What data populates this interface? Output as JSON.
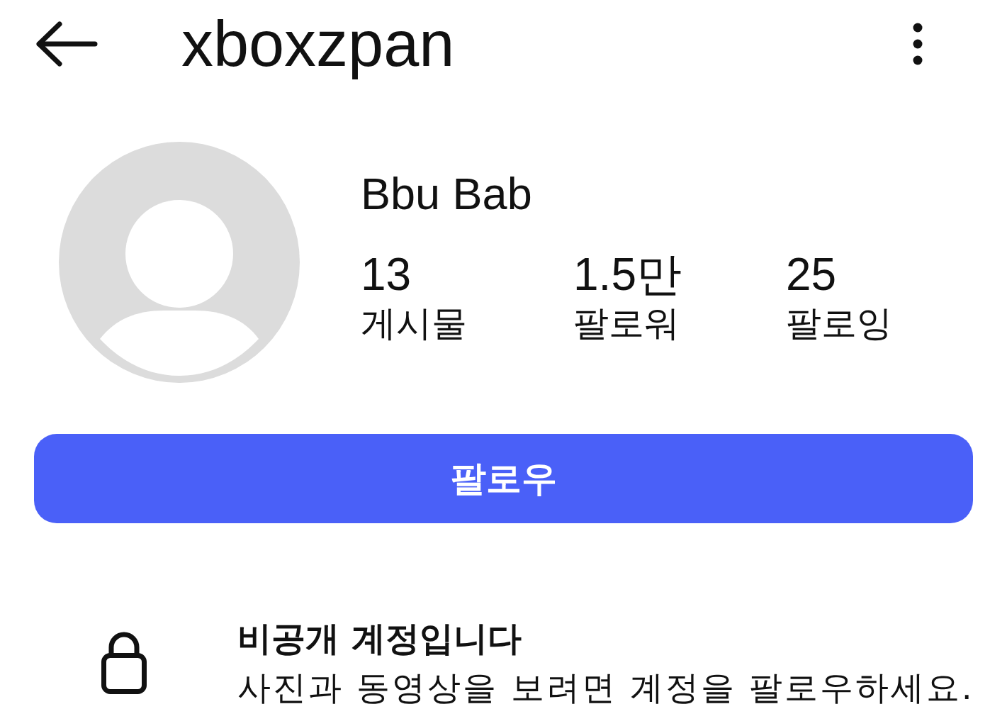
{
  "header": {
    "title": "xboxzpan"
  },
  "profile": {
    "name": "Bbu Bab",
    "stats": [
      {
        "value": "13",
        "label": "게시물"
      },
      {
        "value": "1.5만",
        "label": "팔로워"
      },
      {
        "value": "25",
        "label": "팔로잉"
      }
    ]
  },
  "follow_button": {
    "label": "팔로우"
  },
  "private_notice": {
    "title": "비공개 계정입니다",
    "message": "사진과 동영상을 보려면 계정을 팔로우하세요."
  }
}
